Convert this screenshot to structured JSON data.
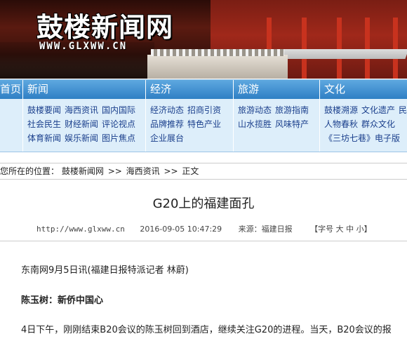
{
  "banner": {
    "title": "鼓楼新闻网",
    "url": "WWW.GLXWW.CN"
  },
  "nav": {
    "home_label": "首页",
    "columns": [
      {
        "label": "新闻",
        "rows": [
          [
            "鼓楼要闻",
            "海西资讯",
            "国内国际"
          ],
          [
            "社会民生",
            "财经新闻",
            "评论视点"
          ],
          [
            "体育新闻",
            "娱乐新闻",
            "图片焦点"
          ]
        ]
      },
      {
        "label": "经济",
        "rows": [
          [
            "经济动态",
            "招商引资"
          ],
          [
            "品牌推荐",
            "特色产业"
          ],
          [
            "企业展台"
          ]
        ]
      },
      {
        "label": "旅游",
        "rows": [
          [
            "旅游动态",
            "旅游指南"
          ],
          [
            "山水揽胜",
            "风味特产"
          ]
        ]
      },
      {
        "label": "文化",
        "rows": [
          [
            "鼓楼溯源",
            "文化遗产",
            "民"
          ],
          [
            "人物春秋",
            "群众文化"
          ],
          [
            "《三坊七巷》电子版"
          ]
        ]
      }
    ]
  },
  "breadcrumb": {
    "prefix": "您所在的位置：",
    "items": [
      "鼓楼新闻网",
      ">>",
      "海西资讯",
      ">>",
      "正文"
    ]
  },
  "article": {
    "title": "G20上的福建面孔",
    "url": "http://www.glxww.cn",
    "datetime": "2016-09-05 10:47:29",
    "source": "来源：福建日报",
    "font_size_label": "【字号 大 中 小】",
    "paragraphs": [
      "东南网9月5日讯(福建日报特派记者 林蔚)",
      "陈玉树：新侨中国心",
      "4日下午，刚刚结束B20会议的陈玉树回到酒店，继续关注G20的进程。当天，B20会议的报"
    ]
  }
}
